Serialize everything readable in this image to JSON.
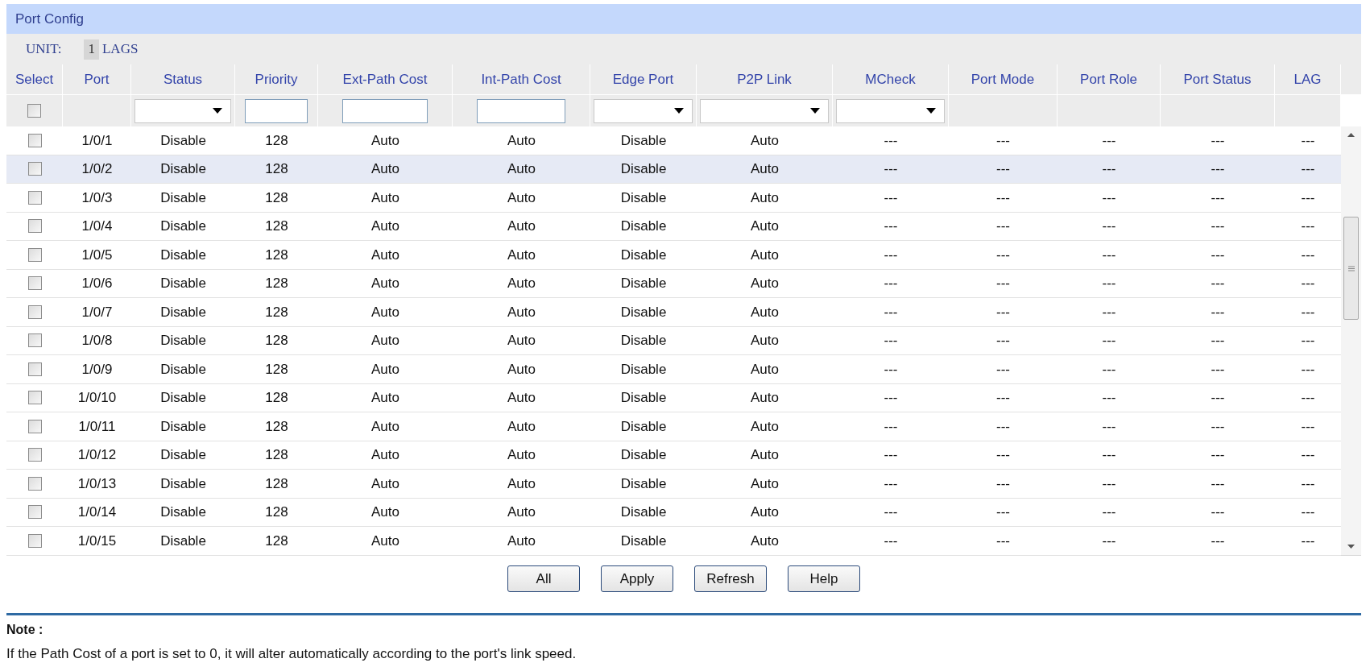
{
  "panel": {
    "title": "Port Config"
  },
  "unit": {
    "label": "UNIT:",
    "units": [
      {
        "text": "1",
        "selected": true
      }
    ],
    "lags": "LAGS"
  },
  "table": {
    "select_column": "Select",
    "columns": [
      "Port",
      "Status",
      "Priority",
      "Ext-Path Cost",
      "Int-Path Cost",
      "Edge Port",
      "P2P Link",
      "MCheck",
      "Port Mode",
      "Port Role",
      "Port Status",
      "LAG"
    ],
    "filters": [
      {
        "kind": "checkbox",
        "checked": false
      },
      {
        "kind": "empty"
      },
      {
        "kind": "select"
      },
      {
        "kind": "text"
      },
      {
        "kind": "text"
      },
      {
        "kind": "text"
      },
      {
        "kind": "select"
      },
      {
        "kind": "select"
      },
      {
        "kind": "select"
      },
      {
        "kind": "empty"
      },
      {
        "kind": "empty"
      },
      {
        "kind": "empty"
      },
      {
        "kind": "empty"
      }
    ],
    "rows": [
      {
        "checked": false,
        "highlighted": false,
        "cells": [
          "1/0/1",
          "Disable",
          "128",
          "Auto",
          "Auto",
          "Disable",
          "Auto",
          "---",
          "---",
          "---",
          "---",
          "---"
        ]
      },
      {
        "checked": false,
        "highlighted": true,
        "cells": [
          "1/0/2",
          "Disable",
          "128",
          "Auto",
          "Auto",
          "Disable",
          "Auto",
          "---",
          "---",
          "---",
          "---",
          "---"
        ]
      },
      {
        "checked": false,
        "highlighted": false,
        "cells": [
          "1/0/3",
          "Disable",
          "128",
          "Auto",
          "Auto",
          "Disable",
          "Auto",
          "---",
          "---",
          "---",
          "---",
          "---"
        ]
      },
      {
        "checked": false,
        "highlighted": false,
        "cells": [
          "1/0/4",
          "Disable",
          "128",
          "Auto",
          "Auto",
          "Disable",
          "Auto",
          "---",
          "---",
          "---",
          "---",
          "---"
        ]
      },
      {
        "checked": false,
        "highlighted": false,
        "cells": [
          "1/0/5",
          "Disable",
          "128",
          "Auto",
          "Auto",
          "Disable",
          "Auto",
          "---",
          "---",
          "---",
          "---",
          "---"
        ]
      },
      {
        "checked": false,
        "highlighted": false,
        "cells": [
          "1/0/6",
          "Disable",
          "128",
          "Auto",
          "Auto",
          "Disable",
          "Auto",
          "---",
          "---",
          "---",
          "---",
          "---"
        ]
      },
      {
        "checked": false,
        "highlighted": false,
        "cells": [
          "1/0/7",
          "Disable",
          "128",
          "Auto",
          "Auto",
          "Disable",
          "Auto",
          "---",
          "---",
          "---",
          "---",
          "---"
        ]
      },
      {
        "checked": false,
        "highlighted": false,
        "cells": [
          "1/0/8",
          "Disable",
          "128",
          "Auto",
          "Auto",
          "Disable",
          "Auto",
          "---",
          "---",
          "---",
          "---",
          "---"
        ]
      },
      {
        "checked": false,
        "highlighted": false,
        "cells": [
          "1/0/9",
          "Disable",
          "128",
          "Auto",
          "Auto",
          "Disable",
          "Auto",
          "---",
          "---",
          "---",
          "---",
          "---"
        ]
      },
      {
        "checked": false,
        "highlighted": false,
        "cells": [
          "1/0/10",
          "Disable",
          "128",
          "Auto",
          "Auto",
          "Disable",
          "Auto",
          "---",
          "---",
          "---",
          "---",
          "---"
        ]
      },
      {
        "checked": false,
        "highlighted": false,
        "cells": [
          "1/0/11",
          "Disable",
          "128",
          "Auto",
          "Auto",
          "Disable",
          "Auto",
          "---",
          "---",
          "---",
          "---",
          "---"
        ]
      },
      {
        "checked": false,
        "highlighted": false,
        "cells": [
          "1/0/12",
          "Disable",
          "128",
          "Auto",
          "Auto",
          "Disable",
          "Auto",
          "---",
          "---",
          "---",
          "---",
          "---"
        ]
      },
      {
        "checked": false,
        "highlighted": false,
        "cells": [
          "1/0/13",
          "Disable",
          "128",
          "Auto",
          "Auto",
          "Disable",
          "Auto",
          "---",
          "---",
          "---",
          "---",
          "---"
        ]
      },
      {
        "checked": false,
        "highlighted": false,
        "cells": [
          "1/0/14",
          "Disable",
          "128",
          "Auto",
          "Auto",
          "Disable",
          "Auto",
          "---",
          "---",
          "---",
          "---",
          "---"
        ]
      },
      {
        "checked": false,
        "highlighted": false,
        "cells": [
          "1/0/15",
          "Disable",
          "128",
          "Auto",
          "Auto",
          "Disable",
          "Auto",
          "---",
          "---",
          "---",
          "---",
          "---"
        ]
      }
    ]
  },
  "buttons": [
    "All",
    "Apply",
    "Refresh",
    "Help"
  ],
  "note": {
    "title": "Note :",
    "text": "If the Path Cost of a port is set to 0, it will alter automatically according to the port's link speed."
  }
}
